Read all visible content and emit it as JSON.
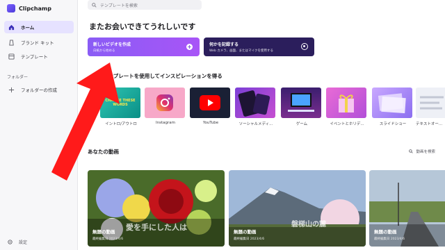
{
  "app": {
    "name": "Clipchamp"
  },
  "sidebar": {
    "items": [
      {
        "label": "ホーム",
        "icon": "home-icon"
      },
      {
        "label": "ブランド キット",
        "icon": "brand-kit-icon"
      },
      {
        "label": "テンプレート",
        "icon": "template-icon"
      }
    ],
    "folders_label": "フォルダー",
    "new_folder_label": "フォルダーの作成",
    "settings_label": "設定"
  },
  "search": {
    "placeholder": "テンプレートを検索"
  },
  "greeting": "またお会いできてうれしいです",
  "cta": {
    "new_video": {
      "title": "新しいビデオを作成",
      "subtitle": "白紙から始める"
    },
    "record": {
      "title": "何かを記録する",
      "subtitle": "Web カメラ、画面、またはマイクを使用する"
    }
  },
  "inspiration_title": "テンプレートを使用してインスピレーションを得る",
  "templates": [
    {
      "label": "イントロ/アウトロ",
      "thumb_text": "CHANGE THESE WORDS"
    },
    {
      "label": "Instagram"
    },
    {
      "label": "YouTube"
    },
    {
      "label": "ソーシャルメディ..."
    },
    {
      "label": "ゲーム"
    },
    {
      "label": "イベントとホリデ..."
    },
    {
      "label": "スライドショー"
    },
    {
      "label": "テキストオー..."
    }
  ],
  "videos_title": "あなたの動画",
  "sort_label": "動画を検索",
  "videos": [
    {
      "title": "無題の動画",
      "date": "最終編集日 2023/4/6",
      "caption": "愛を手にした人は"
    },
    {
      "title": "無題の動画",
      "date": "最終編集日 2023/4/6",
      "caption": "磐梯山の麓"
    },
    {
      "title": "無題の動画",
      "date": "最終編集日 2023/4/6"
    }
  ],
  "colors": {
    "accent": "#7b61ff",
    "cta_primary": "#9b5cf6",
    "cta_secondary": "#2b1e5c",
    "annotation_arrow": "#ff1a1a"
  }
}
